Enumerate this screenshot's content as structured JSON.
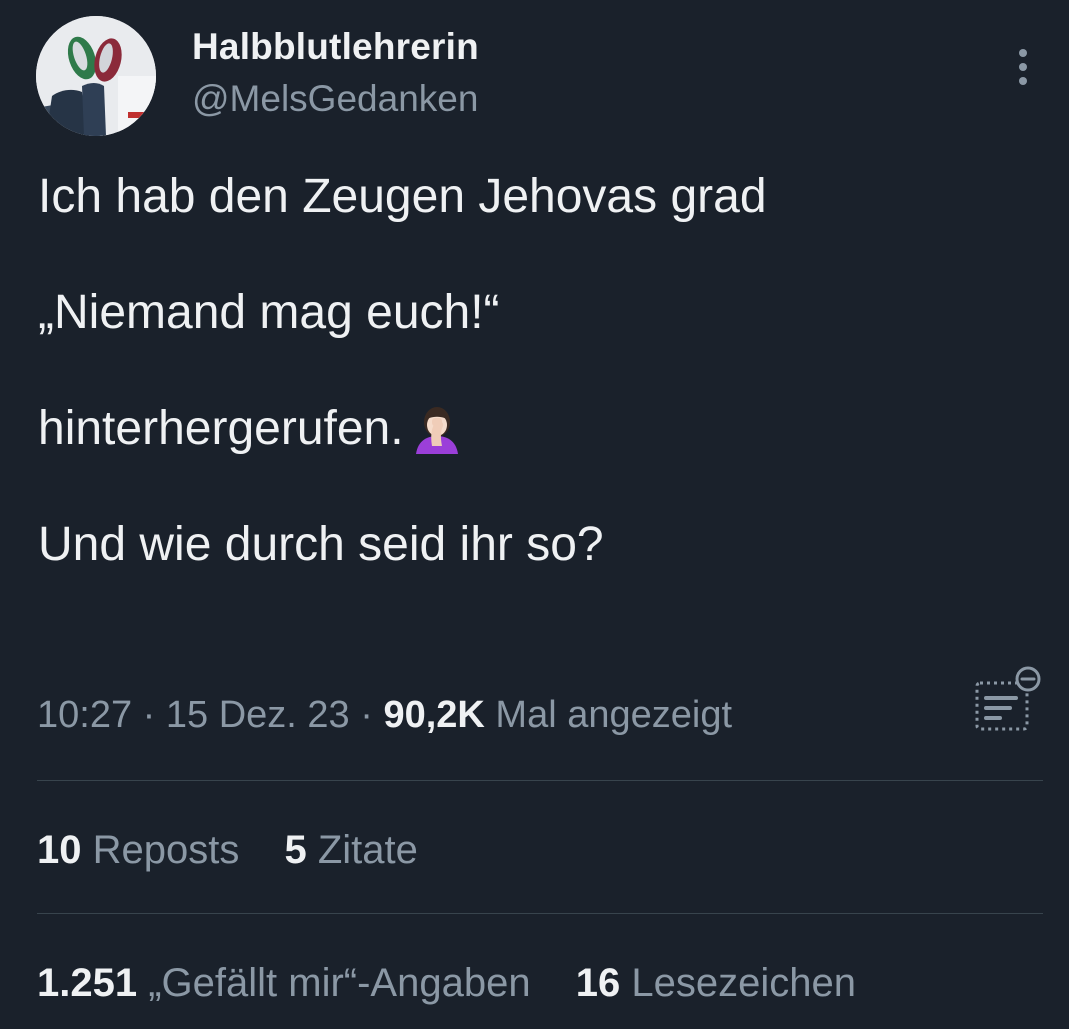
{
  "author": {
    "display_name": "Halbblutlehrerin",
    "handle": "@MelsGedanken"
  },
  "tweet": {
    "lines": [
      "Ich hab den Zeugen Jehovas grad",
      "",
      "„Niemand mag euch!“",
      "",
      "hinterhergerufen.",
      "",
      "Und wie durch seid ihr so?"
    ]
  },
  "meta": {
    "time": "10:27",
    "separator1": " · ",
    "date": "15 Dez. 23",
    "separator2": " · ",
    "views_count": "90,2K",
    "views_label": " Mal angezeigt"
  },
  "stats": {
    "reposts_count": "10",
    "reposts_label": " Reposts",
    "quotes_count": "5",
    "quotes_label": " Zitate",
    "likes_count": "1.251",
    "likes_label": " „Gefällt mir“-Angaben",
    "bookmarks_count": "16",
    "bookmarks_label": " Lesezeichen"
  },
  "colors": {
    "background": "#1a212b",
    "text_primary": "#eff1f3",
    "text_secondary": "#8b98a5",
    "divider": "#38444d"
  },
  "icons": {
    "more": "more-vertical-icon",
    "analytics": "analytics-icon",
    "emoji": "woman-facepalming-emoji"
  }
}
